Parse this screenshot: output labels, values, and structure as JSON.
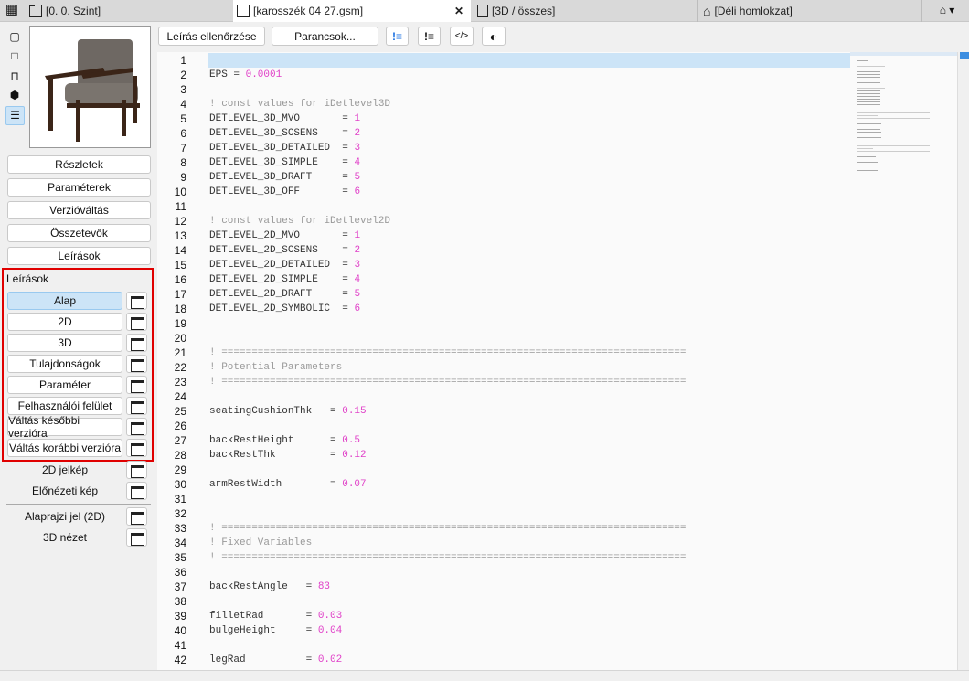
{
  "tabs": [
    {
      "label": "[0. 0. Szint]",
      "icon": "floorplan-icon"
    },
    {
      "label": "[karosszék 04 27.gsm]",
      "icon": "gdl-object-icon",
      "active": true
    },
    {
      "label": "[3D / összes]",
      "icon": "3d-view-icon"
    },
    {
      "label": "[Déli homlokzat]",
      "icon": "elevation-icon"
    }
  ],
  "toolbar": {
    "check_script": "Leírás ellenőrzése",
    "commands": "Parancsok..."
  },
  "sidebar": {
    "main_buttons": [
      "Részletek",
      "Paraméterek",
      "Verzióváltás",
      "Összetevők",
      "Leírások"
    ],
    "scripts_title": "Leírások",
    "scripts": [
      "Alap",
      "2D",
      "3D",
      "Tulajdonságok",
      "Paraméter",
      "Felhasználói felület",
      "Váltás későbbi verzióra",
      "Váltás korábbi verzióra"
    ],
    "selected_script": "Alap",
    "extra": [
      "2D jelkép",
      "Előnézeti kép"
    ],
    "extra2": [
      "Alaprajzi jel (2D)",
      "3D nézet"
    ]
  },
  "code": [
    {},
    {
      "name": "EPS ",
      "op": "= ",
      "value": "0.0001"
    },
    {},
    {
      "comment": "! const values for iDetlevel3D"
    },
    {
      "name": "DETLEVEL_3D_MVO       ",
      "op": "= ",
      "value": "1"
    },
    {
      "name": "DETLEVEL_3D_SCSENS    ",
      "op": "= ",
      "value": "2"
    },
    {
      "name": "DETLEVEL_3D_DETAILED  ",
      "op": "= ",
      "value": "3"
    },
    {
      "name": "DETLEVEL_3D_SIMPLE    ",
      "op": "= ",
      "value": "4"
    },
    {
      "name": "DETLEVEL_3D_DRAFT     ",
      "op": "= ",
      "value": "5"
    },
    {
      "name": "DETLEVEL_3D_OFF       ",
      "op": "= ",
      "value": "6"
    },
    {},
    {
      "comment": "! const values for iDetlevel2D"
    },
    {
      "name": "DETLEVEL_2D_MVO       ",
      "op": "= ",
      "value": "1"
    },
    {
      "name": "DETLEVEL_2D_SCSENS    ",
      "op": "= ",
      "value": "2"
    },
    {
      "name": "DETLEVEL_2D_DETAILED  ",
      "op": "= ",
      "value": "3"
    },
    {
      "name": "DETLEVEL_2D_SIMPLE    ",
      "op": "= ",
      "value": "4"
    },
    {
      "name": "DETLEVEL_2D_DRAFT     ",
      "op": "= ",
      "value": "5"
    },
    {
      "name": "DETLEVEL_2D_SYMBOLIC  ",
      "op": "= ",
      "value": "6"
    },
    {},
    {},
    {
      "comment": "! ============================================================================="
    },
    {
      "comment": "! Potential Parameters"
    },
    {
      "comment": "! ============================================================================="
    },
    {},
    {
      "name": "seatingCushionThk   ",
      "op": "= ",
      "value": "0.15"
    },
    {},
    {
      "name": "backRestHeight      ",
      "op": "= ",
      "value": "0.5"
    },
    {
      "name": "backRestThk         ",
      "op": "= ",
      "value": "0.12"
    },
    {},
    {
      "name": "armRestWidth        ",
      "op": "= ",
      "value": "0.07"
    },
    {},
    {},
    {
      "comment": "! ============================================================================="
    },
    {
      "comment": "! Fixed Variables"
    },
    {
      "comment": "! ============================================================================="
    },
    {},
    {
      "name": "backRestAngle   ",
      "op": "= ",
      "value": "83"
    },
    {},
    {
      "name": "filletRad       ",
      "op": "= ",
      "value": "0.03"
    },
    {
      "name": "bulgeHeight     ",
      "op": "= ",
      "value": "0.04"
    },
    {},
    {
      "name": "legRad          ",
      "op": "= ",
      "value": "0.02"
    }
  ],
  "colors": {
    "value": "#e040c8",
    "comment": "#999999",
    "highlight": "#cce4f7",
    "frame": "#e00000"
  }
}
